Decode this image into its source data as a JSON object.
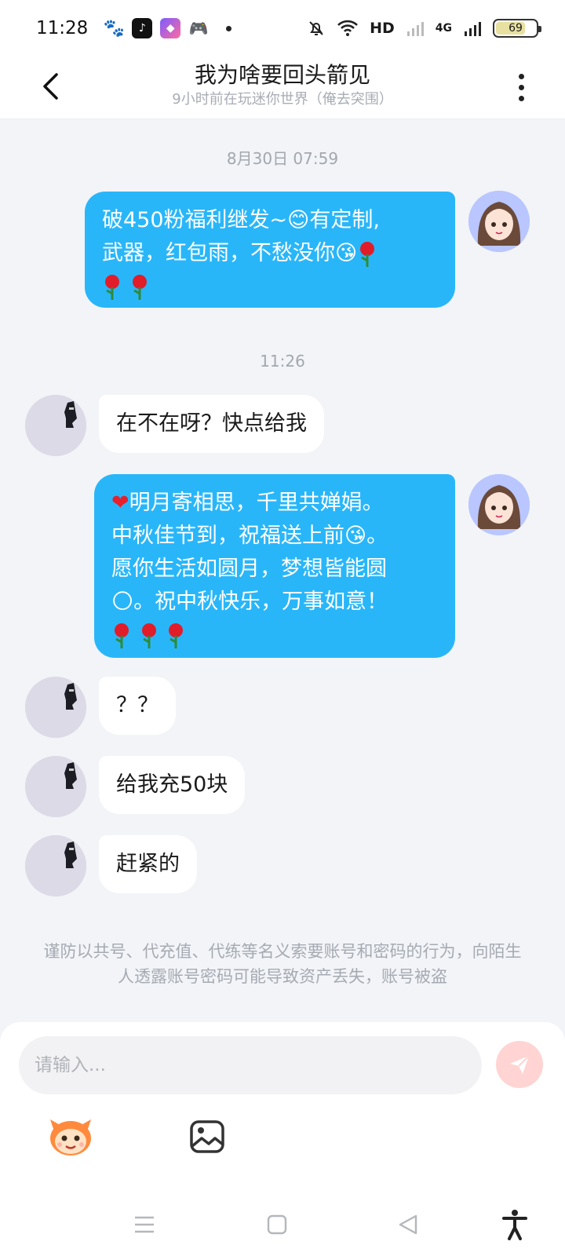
{
  "status_bar": {
    "time": "11:28",
    "network": "HD",
    "cell": "4G",
    "battery_level": "69",
    "battery_fraction": 0.69
  },
  "header": {
    "title": "我为啥要回头箭见",
    "subtitle": "9小时前在玩迷你世界（俺去突围）"
  },
  "messages": {
    "ts1": "8月30日 07:59",
    "m1_line1": "破450粉福利继发~",
    "m1_line1b": "有定制,",
    "m1_line2": "武器，红包雨，不愁没你",
    "ts2": "11:26",
    "m2": "在不在呀？快点给我",
    "m3_line1": "明月寄相思，千里共婵娟。",
    "m3_line2": "中秋佳节到，祝福送上前",
    "m3_line2b": "。",
    "m3_line3": "愿你生活如圆月，梦想皆能圆",
    "m3_line4": "。祝中秋快乐，万事如意！",
    "m4": "？？",
    "m5": "给我充50块",
    "m6": "赶紧的"
  },
  "warning": "谨防以共号、代充值、代练等名义索要账号和密码的行为，向陌生人透露账号密码可能导致资产丢失，账号被盗",
  "input": {
    "placeholder": "请输入..."
  },
  "icons": {
    "back": "chevron-left-icon",
    "more": "more-vertical-icon",
    "send": "paper-plane-icon",
    "emoji": "monkey-face-icon",
    "image": "image-icon",
    "nav_menu": "menu-icon",
    "nav_home": "square-icon",
    "nav_back": "triangle-back-icon",
    "accessibility": "accessibility-icon"
  },
  "colors": {
    "bubble_out": "#29b6f9",
    "bubble_in": "#ffffff",
    "background": "#f2f4f8",
    "send_disabled": "#ffd4d2"
  }
}
